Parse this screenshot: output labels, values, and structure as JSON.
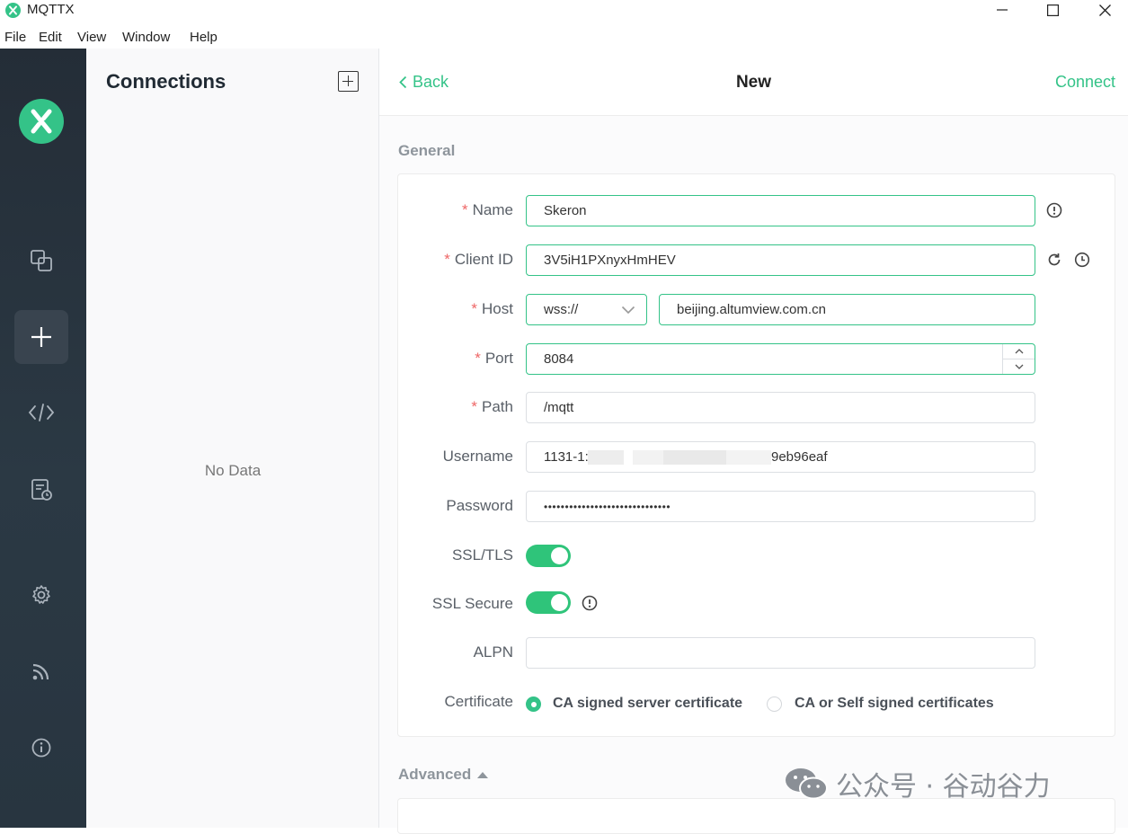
{
  "window": {
    "title": "MQTTX"
  },
  "menu": [
    "File",
    "Edit",
    "View",
    "Window",
    "Help"
  ],
  "rail": {
    "items": [
      {
        "icon": "connections-icon"
      },
      {
        "icon": "plus-icon",
        "active": true
      },
      {
        "icon": "code-icon"
      },
      {
        "icon": "log-icon"
      },
      {
        "icon": "gear-icon"
      },
      {
        "icon": "rss-icon"
      },
      {
        "icon": "info-icon"
      }
    ]
  },
  "connections": {
    "title": "Connections",
    "empty_text": "No Data"
  },
  "header": {
    "back_label": "Back",
    "title": "New",
    "connect_label": "Connect"
  },
  "general": {
    "section_title": "General",
    "name": {
      "label": "Name",
      "value": "Skeron"
    },
    "client_id": {
      "label": "Client ID",
      "value": "3V5iH1PXnyxHmHEV"
    },
    "host": {
      "label": "Host",
      "protocol": "wss://",
      "value": "beijing.altumview.com.cn"
    },
    "port": {
      "label": "Port",
      "value": "8084"
    },
    "path": {
      "label": "Path",
      "value": "/mqtt"
    },
    "username": {
      "label": "Username",
      "value_start": "1131-1:",
      "value_end": "9eb96eaf"
    },
    "password": {
      "label": "Password",
      "value": "••••••••••••••••••••••••••••••"
    },
    "ssl_tls": {
      "label": "SSL/TLS",
      "on": true
    },
    "ssl_secure": {
      "label": "SSL Secure",
      "on": true
    },
    "alpn": {
      "label": "ALPN",
      "value": ""
    },
    "certificate": {
      "label": "Certificate",
      "options": [
        "CA signed server certificate",
        "CA or Self signed certificates"
      ],
      "selected": 0
    }
  },
  "advanced": {
    "section_title": "Advanced"
  },
  "watermark": {
    "text": "公众号 · 谷动谷力"
  },
  "colors": {
    "accent": "#34c388",
    "rail_bg": "#2b3944",
    "required": "#ee6666"
  }
}
